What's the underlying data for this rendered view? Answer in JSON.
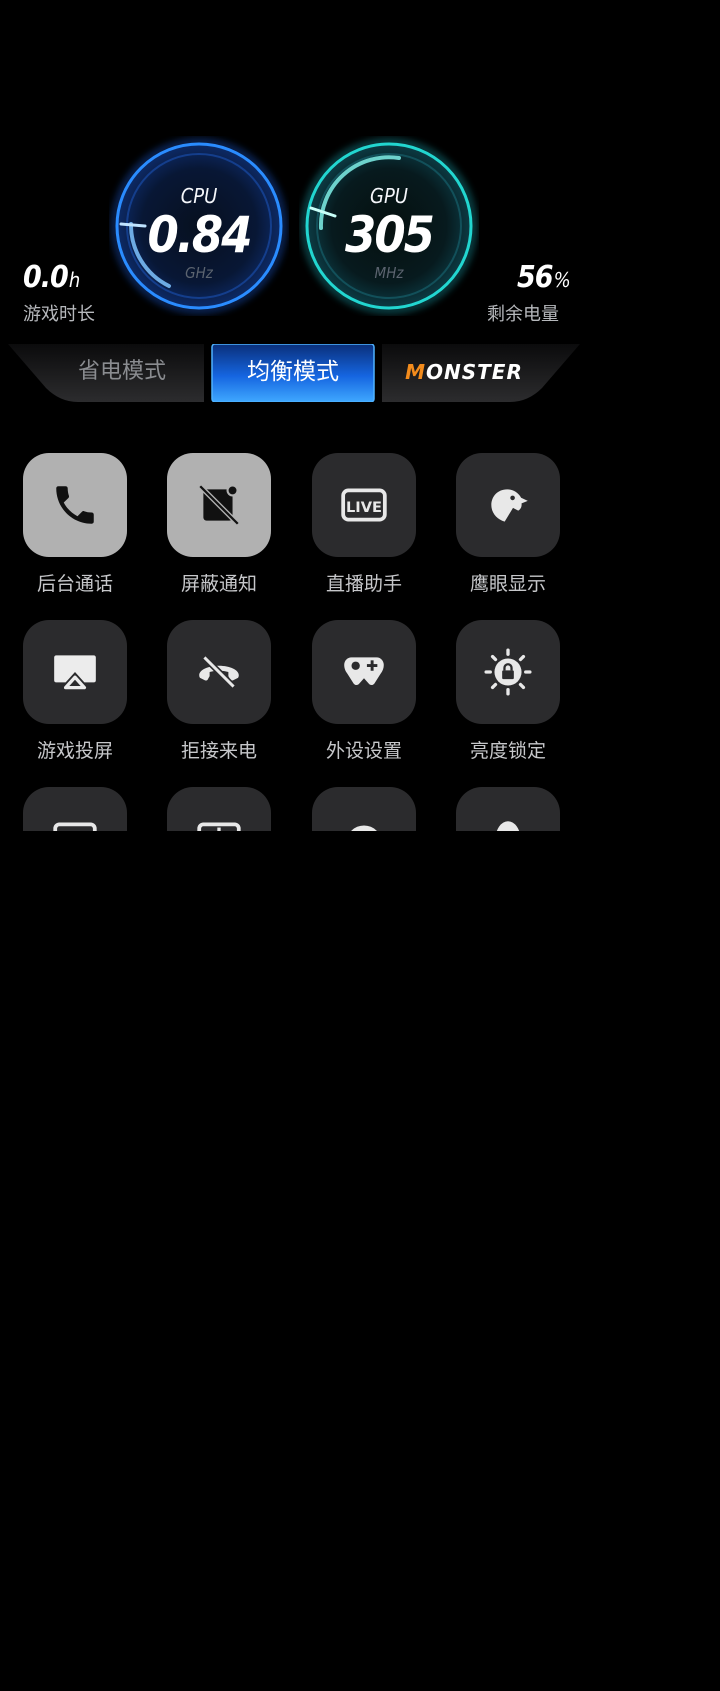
{
  "gauges": {
    "cpu": {
      "label": "CPU",
      "value": "0.84",
      "unit": "GHz"
    },
    "gpu": {
      "label": "GPU",
      "value": "305",
      "unit": "MHz"
    }
  },
  "play_time": {
    "value": "0.0",
    "unit": "h",
    "label": "游戏时长"
  },
  "battery": {
    "value": "56",
    "unit": "%",
    "label": "剩余电量"
  },
  "modes": {
    "save": "省电模式",
    "balance": "均衡模式",
    "monster_first": "M",
    "monster_rest": "ONSTER",
    "active": "balance"
  },
  "tools": [
    {
      "label": "后台通话",
      "icon": "phone-icon",
      "active": true
    },
    {
      "label": "屏蔽通知",
      "icon": "block-notification-icon",
      "active": true
    },
    {
      "label": "直播助手",
      "icon": "live-icon",
      "active": false
    },
    {
      "label": "鹰眼显示",
      "icon": "eagle-icon",
      "active": false
    },
    {
      "label": "游戏投屏",
      "icon": "screen-cast-icon",
      "active": false
    },
    {
      "label": "拒接来电",
      "icon": "reject-call-icon",
      "active": false
    },
    {
      "label": "外设设置",
      "icon": "gamepad-icon",
      "active": false
    },
    {
      "label": "亮度锁定",
      "icon": "brightness-lock-icon",
      "active": false
    },
    {
      "label": "",
      "icon": "screenshot-icon",
      "active": false
    },
    {
      "label": "",
      "icon": "record-icon",
      "active": false
    },
    {
      "label": "",
      "icon": "game-face-icon",
      "active": false
    },
    {
      "label": "",
      "icon": "person-icon",
      "active": false
    }
  ],
  "colors": {
    "accent_blue": "#1f7cf0",
    "monster_orange": "#f28b1c",
    "gauge_cpu": "#2a8cff",
    "gauge_gpu": "#22d6d0"
  }
}
